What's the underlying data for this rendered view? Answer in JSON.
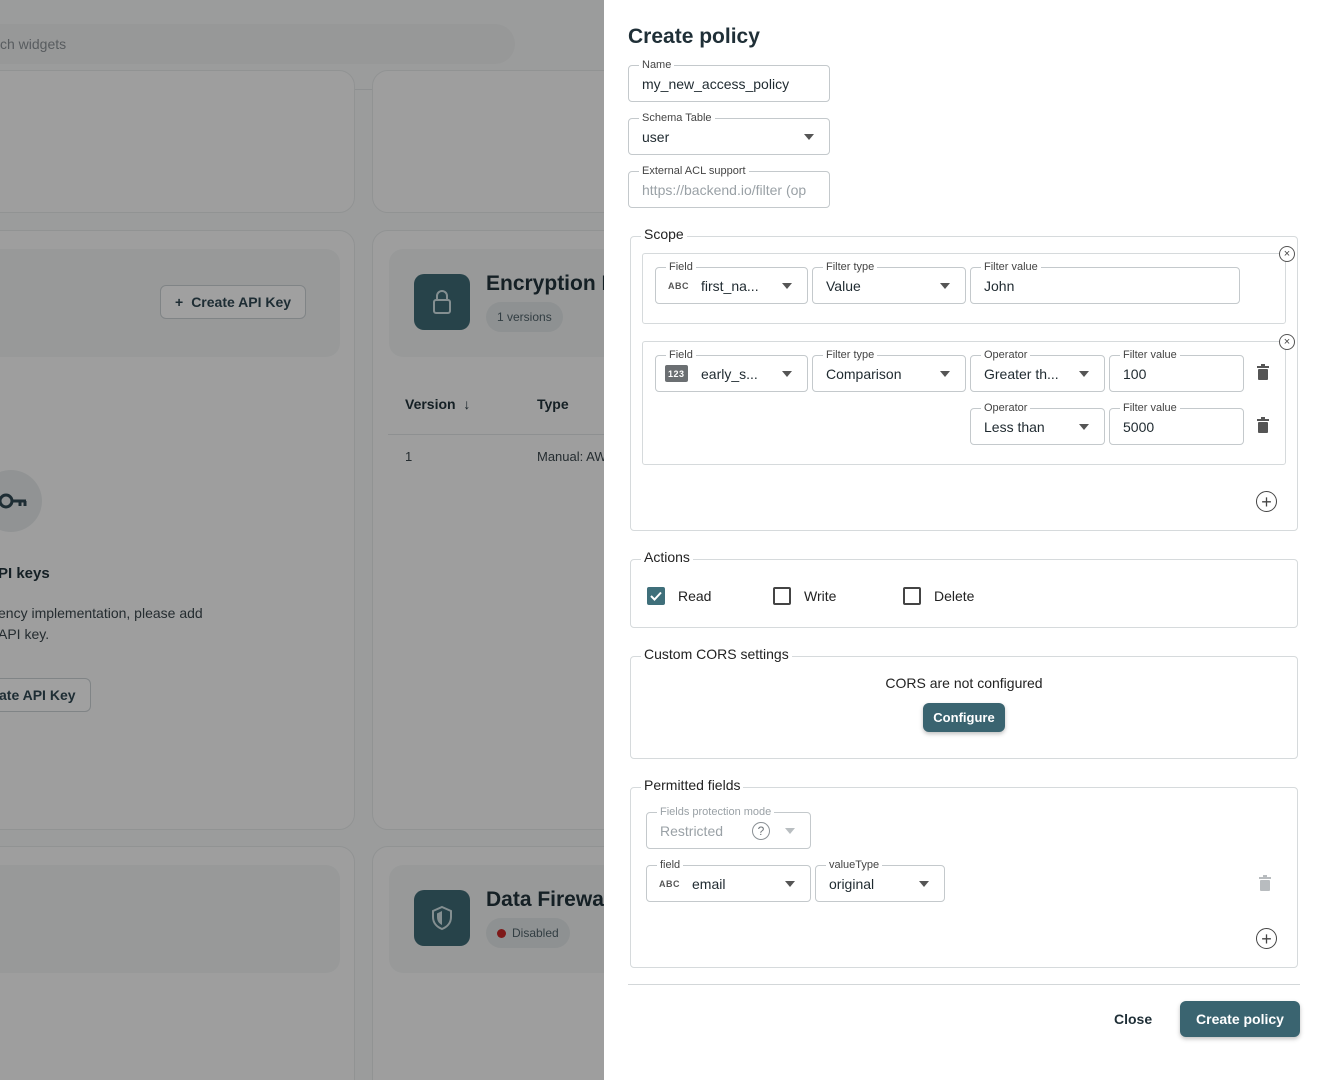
{
  "background": {
    "search_placeholder": "ch widgets",
    "create_api_key_label": "Create API Key",
    "encryption": {
      "title": "Encryption K",
      "chip": "1 versions",
      "col_version": "Version",
      "col_type": "Type",
      "row_version": "1",
      "row_type": "Manual: AW"
    },
    "api_keys": {
      "title": "PI keys",
      "line1": "ency implementation, please add",
      "line2": "API key.",
      "button": "ate API Key"
    },
    "firewall": {
      "title": "Data Firewall",
      "chip": "Disabled"
    }
  },
  "drawer": {
    "title": "Create policy",
    "name": {
      "label": "Name",
      "value": "my_new_access_policy"
    },
    "schema_table": {
      "label": "Schema Table",
      "value": "user"
    },
    "external_acl": {
      "label": "External ACL support",
      "placeholder": "https://backend.io/filter (op"
    },
    "scope": {
      "label": "Scope",
      "rule1": {
        "field_label": "Field",
        "field_type": "ABC",
        "field_value": "first_na...",
        "filter_type_label": "Filter type",
        "filter_type_value": "Value",
        "filter_value_label": "Filter value",
        "filter_value": "John"
      },
      "rule2": {
        "field_label": "Field",
        "field_type": "123",
        "field_value": "early_s...",
        "filter_type_label": "Filter type",
        "filter_type_value": "Comparison",
        "conditions": [
          {
            "operator_label": "Operator",
            "operator_value": "Greater th...",
            "value_label": "Filter value",
            "value": "100"
          },
          {
            "operator_label": "Operator",
            "operator_value": "Less than",
            "value_label": "Filter value",
            "value": "5000"
          }
        ]
      }
    },
    "actions": {
      "label": "Actions",
      "items": [
        {
          "label": "Read",
          "checked": true
        },
        {
          "label": "Write",
          "checked": false
        },
        {
          "label": "Delete",
          "checked": false
        }
      ]
    },
    "cors": {
      "label": "Custom CORS settings",
      "status": "CORS are not configured",
      "button": "Configure"
    },
    "permitted_fields": {
      "label": "Permitted fields",
      "mode_label": "Fields protection mode",
      "mode_value": "Restricted",
      "field_label": "field",
      "field_type": "ABC",
      "field_value": "email",
      "value_type_label": "valueType",
      "value_type_value": "original"
    },
    "footer": {
      "close": "Close",
      "create": "Create policy"
    }
  }
}
